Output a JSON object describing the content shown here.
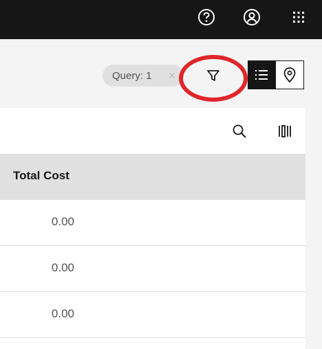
{
  "header": {
    "icons": [
      "help-icon",
      "user-icon",
      "app-switcher-icon"
    ]
  },
  "toolbar": {
    "query_chip_label": "Query: 1",
    "chip_close_glyph": "×",
    "filter_icon": "filter-icon",
    "view_list_icon": "list-icon",
    "view_map_icon": "location-pin-icon"
  },
  "table": {
    "tools": [
      "search-icon",
      "column-settings-icon"
    ],
    "column_header": "Total Cost",
    "rows": [
      "0.00",
      "0.00",
      "0.00"
    ]
  },
  "colors": {
    "header_bg": "#161616",
    "highlight": "#e0262b",
    "page_bg": "#f4f4f4"
  }
}
